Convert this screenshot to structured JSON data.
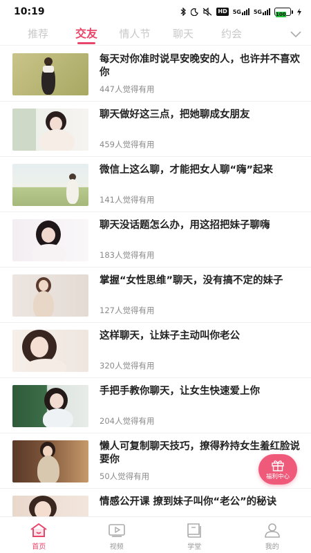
{
  "status_bar": {
    "time": "10:19",
    "network_1": "5G",
    "network_2": "5G",
    "hd": "HD",
    "battery": "100"
  },
  "tabs": [
    {
      "label": "推荐",
      "active": false
    },
    {
      "label": "交友",
      "active": true
    },
    {
      "label": "情人节",
      "active": false
    },
    {
      "label": "聊天",
      "active": false
    },
    {
      "label": "约会",
      "active": false
    }
  ],
  "articles": [
    {
      "title": "每天对你准时说早安晚安的人，也许并不喜欢你",
      "meta": "447人觉得有用"
    },
    {
      "title": "聊天做好这三点，把她聊成女朋友",
      "meta": "459人觉得有用"
    },
    {
      "title": "微信上这么聊，才能把女人聊“嗨”起来",
      "meta": "141人觉得有用"
    },
    {
      "title": "聊天没话题怎么办，用这招把妹子聊嗨",
      "meta": "183人觉得有用"
    },
    {
      "title": "掌握“女性思维”聊天，没有搞不定的妹子",
      "meta": "127人觉得有用"
    },
    {
      "title": "这样聊天，让妹子主动叫你老公",
      "meta": "320人觉得有用"
    },
    {
      "title": "手把手教你聊天，让女生快速爱上你",
      "meta": "204人觉得有用"
    },
    {
      "title": "懒人可复制聊天技巧，撩得矜持女生羞红脸说要你",
      "meta": "50人觉得有用"
    },
    {
      "title": "情感公开课 撩到妹子叫你“老公”的秘诀",
      "meta": ""
    }
  ],
  "fab": {
    "label": "福利中心"
  },
  "bottom_nav": [
    {
      "label": "首页",
      "active": true
    },
    {
      "label": "视频",
      "active": false
    },
    {
      "label": "学堂",
      "active": false
    },
    {
      "label": "我的",
      "active": false
    }
  ],
  "colors": {
    "accent": "#e8456a",
    "inactive_tab": "#c8c8c8",
    "meta_text": "#8a8a8a"
  }
}
